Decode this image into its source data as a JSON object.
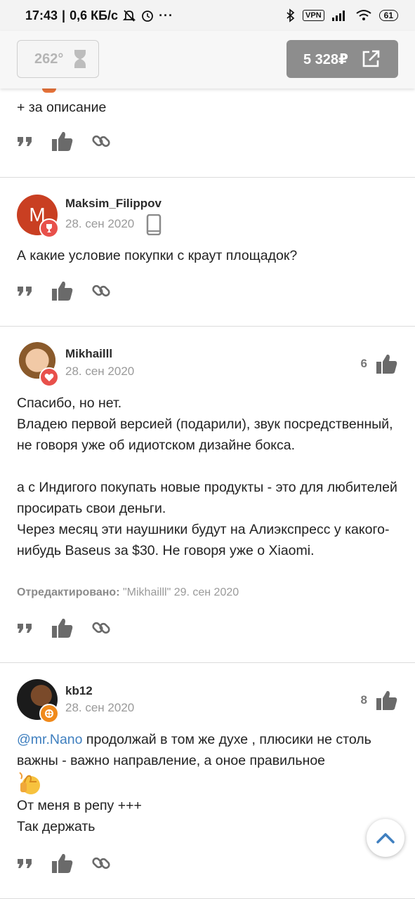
{
  "status_bar": {
    "time": "17:43",
    "speed": "0,6 КБ/с",
    "vpn": "VPN",
    "battery": "61"
  },
  "top_bar": {
    "temperature": "262°",
    "price": "5 328₽"
  },
  "comments": [
    {
      "text": "+ за описание"
    },
    {
      "author": "Maksim_Filippov",
      "avatar_letter": "M",
      "date": "28. сен 2020",
      "text": "А какие условие покупки с краут площадок?"
    },
    {
      "author": "Mikhailll",
      "date": "28. сен 2020",
      "votes": "6",
      "paragraph1": "Спасибо, но нет.",
      "paragraph2": "Владею первой версией (подарили), звук посредственный, не говоря уже об идиотском дизайне бокса.",
      "paragraph3": "а с Индигого покупать новые продукты - это для любителей просирать свои деньги.",
      "paragraph4": "Через месяц эти наушники будут на Алиэкспресс у какого-нибудь Baseus за $30. Не говоря уже о Xiaomi.",
      "edited_label": "Отредактировано:",
      "edited_info": "\"Mikhailll\" 29. сен 2020"
    },
    {
      "author": "kb12",
      "date": "28. сен 2020",
      "votes": "8",
      "mention": "@mr.Nano",
      "text_after_mention": " продолжай в том же духе , плюсики не столь важны - важно направление, а оное правильное",
      "line2": "От меня в репу +++",
      "line3": "Так держать"
    }
  ],
  "icons": {
    "quote": "quote-icon",
    "like": "thumbs-up-icon",
    "link": "link-icon",
    "hourglass": "hourglass-icon",
    "external": "external-link-icon",
    "scroll_top": "chevron-up-icon"
  },
  "colors": {
    "accent_blue": "#3f7fbf",
    "avatar_red": "#c93f22",
    "badge_red": "#e8504b",
    "price_button": "#8d8d8d"
  }
}
